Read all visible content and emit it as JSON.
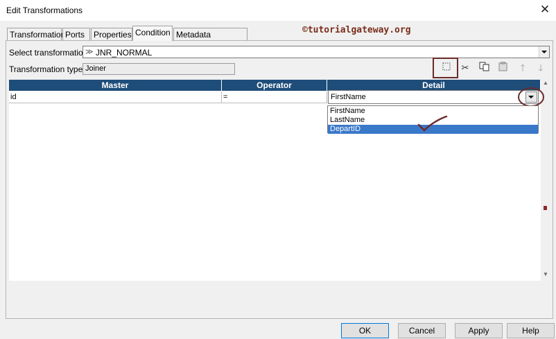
{
  "window": {
    "title": "Edit Transformations"
  },
  "tabs": [
    {
      "label": "Transformation"
    },
    {
      "label": "Ports"
    },
    {
      "label": "Properties"
    },
    {
      "label": "Condition"
    },
    {
      "label": "Metadata Extensions"
    }
  ],
  "watermark": "©tutorialgateway.org",
  "form": {
    "select_label": "Select transformation:",
    "select_value": "JNR_NORMAL",
    "type_label": "Transformation type:",
    "type_value": "Joiner"
  },
  "toolbar": {
    "icons": [
      "new-icon",
      "cut-icon",
      "copy-icon",
      "paste-icon",
      "move-up-icon",
      "move-down-icon"
    ]
  },
  "grid": {
    "columns": [
      "Master",
      "Operator",
      "Detail"
    ],
    "rows": [
      {
        "master": "id",
        "operator": "=",
        "detail": "FirstName"
      }
    ]
  },
  "dropdown": {
    "options": [
      "FirstName",
      "LastName",
      "DepartID"
    ],
    "selected": "DepartID"
  },
  "footer": {
    "ok": "OK",
    "cancel": "Cancel",
    "apply": "Apply",
    "help": "Help"
  },
  "colors": {
    "header_bg": "#1f4d7a",
    "selection": "#3a78c9",
    "annotation": "#7a2e1c"
  }
}
